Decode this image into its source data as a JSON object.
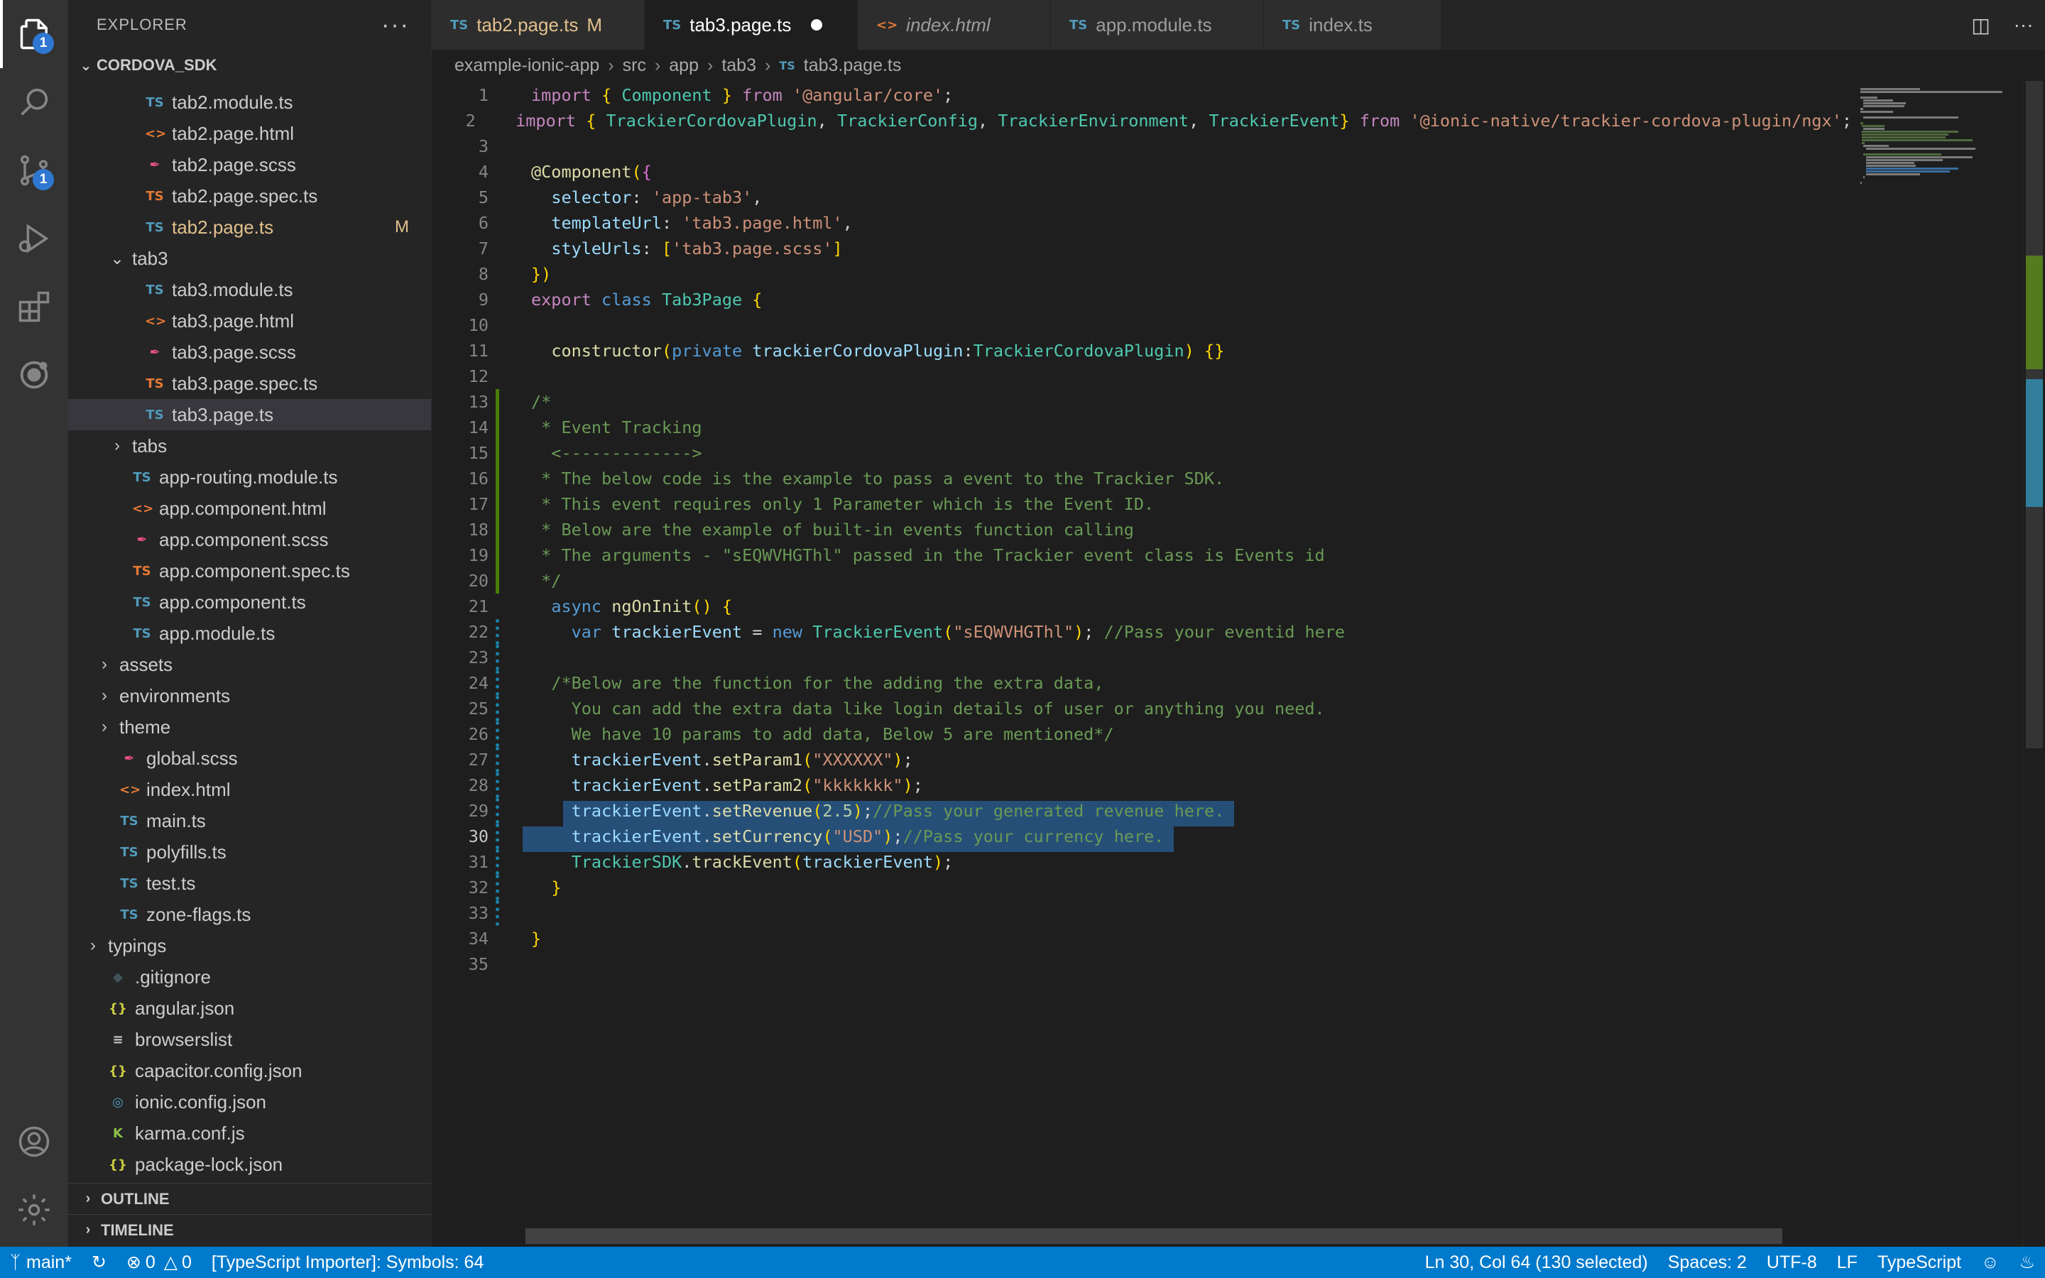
{
  "activity_bar": {
    "explorer_badge": "1",
    "source_control_badge": "1"
  },
  "sidebar": {
    "title": "EXPLORER",
    "more_actions": "···",
    "root": "CORDOVA_SDK",
    "items": [
      {
        "label": "tab2.module.ts",
        "type": "ts",
        "indent": 3
      },
      {
        "label": "tab2.page.html",
        "type": "html",
        "indent": 3
      },
      {
        "label": "tab2.page.scss",
        "type": "scss",
        "indent": 3
      },
      {
        "label": "tab2.page.spec.ts",
        "type": "spec",
        "indent": 3
      },
      {
        "label": "tab2.page.ts",
        "type": "ts",
        "indent": 3,
        "modified": "M"
      },
      {
        "label": "tab3",
        "type": "folder-open",
        "indent": 2
      },
      {
        "label": "tab3.module.ts",
        "type": "ts",
        "indent": 3
      },
      {
        "label": "tab3.page.html",
        "type": "html",
        "indent": 3
      },
      {
        "label": "tab3.page.scss",
        "type": "scss",
        "indent": 3
      },
      {
        "label": "tab3.page.spec.ts",
        "type": "spec",
        "indent": 3
      },
      {
        "label": "tab3.page.ts",
        "type": "ts",
        "indent": 3,
        "selected": true
      },
      {
        "label": "tabs",
        "type": "folder",
        "indent": 2
      },
      {
        "label": "app-routing.module.ts",
        "type": "ts",
        "indent": 2
      },
      {
        "label": "app.component.html",
        "type": "html",
        "indent": 2
      },
      {
        "label": "app.component.scss",
        "type": "scss",
        "indent": 2
      },
      {
        "label": "app.component.spec.ts",
        "type": "spec",
        "indent": 2
      },
      {
        "label": "app.component.ts",
        "type": "ts",
        "indent": 2
      },
      {
        "label": "app.module.ts",
        "type": "ts",
        "indent": 2
      },
      {
        "label": "assets",
        "type": "folder",
        "indent": 1
      },
      {
        "label": "environments",
        "type": "folder",
        "indent": 1
      },
      {
        "label": "theme",
        "type": "folder",
        "indent": 1
      },
      {
        "label": "global.scss",
        "type": "scss",
        "indent": 1
      },
      {
        "label": "index.html",
        "type": "html",
        "indent": 1
      },
      {
        "label": "main.ts",
        "type": "ts",
        "indent": 1
      },
      {
        "label": "polyfills.ts",
        "type": "ts",
        "indent": 1
      },
      {
        "label": "test.ts",
        "type": "ts",
        "indent": 1
      },
      {
        "label": "zone-flags.ts",
        "type": "ts",
        "indent": 1
      },
      {
        "label": "typings",
        "type": "folder",
        "indent": 0
      },
      {
        "label": ".gitignore",
        "type": "git",
        "indent": 0
      },
      {
        "label": "angular.json",
        "type": "json",
        "indent": 0
      },
      {
        "label": "browserslist",
        "type": "list",
        "indent": 0
      },
      {
        "label": "capacitor.config.json",
        "type": "json",
        "indent": 0
      },
      {
        "label": "ionic.config.json",
        "type": "ionic",
        "indent": 0
      },
      {
        "label": "karma.conf.js",
        "type": "karma",
        "indent": 0
      },
      {
        "label": "package-lock.json",
        "type": "json",
        "indent": 0
      }
    ],
    "outline": "OUTLINE",
    "timeline": "TIMELINE"
  },
  "tabs": [
    {
      "label": "tab2.page.ts",
      "icon": "TS",
      "status": "M",
      "kind": "modified"
    },
    {
      "label": "tab3.page.ts",
      "icon": "TS",
      "kind": "active"
    },
    {
      "label": "index.html",
      "icon": "<>",
      "kind": "italic"
    },
    {
      "label": "app.module.ts",
      "icon": "TS",
      "kind": "normal"
    },
    {
      "label": "index.ts",
      "icon": "TS",
      "kind": "normal"
    }
  ],
  "breadcrumbs": [
    "example-ionic-app",
    "src",
    "app",
    "tab3",
    "tab3.page.ts"
  ],
  "breadcrumb_file_icon": "TS",
  "code_lines": [
    "import { Component } from '@angular/core';",
    "import { TrackierCordovaPlugin, TrackierConfig, TrackierEnvironment, TrackierEvent} from '@ionic-native/trackier-cordova-plugin/ngx';",
    "",
    "@Component({",
    "  selector: 'app-tab3',",
    "  templateUrl: 'tab3.page.html',",
    "  styleUrls: ['tab3.page.scss']",
    "})",
    "export class Tab3Page {",
    "",
    "  constructor(private trackierCordovaPlugin:TrackierCordovaPlugin) {}",
    "",
    "/*",
    " * Event Tracking",
    "  <------------->",
    " * The below code is the example to pass a event to the Trackier SDK.",
    " * This event requires only 1 Parameter which is the Event ID.",
    " * Below are the example of built-in events function calling",
    " * The arguments - \"sEQWVHGThl\" passed in the Trackier event class is Events id",
    " */",
    "  async ngOnInit() {",
    "    var trackierEvent = new TrackierEvent(\"sEQWVHGThl\"); //Pass your eventid here",
    "",
    "  /*Below are the function for the adding the extra data,",
    "    You can add the extra data like login details of user or anything you need.",
    "    We have 10 params to add data, Below 5 are mentioned*/",
    "    trackierEvent.setParam1(\"XXXXXX\");",
    "    trackierEvent.setParam2(\"kkkkkkk\");",
    "    trackierEvent.setRevenue(2.5);//Pass your generated revenue here.",
    "    trackierEvent.setCurrency(\"USD\");//Pass your currency here.",
    "    TrackierSDK.trackEvent(trackierEvent);",
    "  }",
    "",
    "}",
    ""
  ],
  "cursor_line": 30,
  "selected_lines": [
    29,
    30
  ],
  "status_bar": {
    "branch": "main*",
    "errors": "0",
    "warnings": "0",
    "importer": "[TypeScript Importer]: Symbols: 64",
    "position": "Ln 30, Col 64 (130 selected)",
    "spaces": "Spaces: 2",
    "encoding": "UTF-8",
    "eol": "LF",
    "language": "TypeScript"
  },
  "colors": {
    "ts": "#519aba",
    "html": "#e37933",
    "scss": "#f55385",
    "spec": "#e37933",
    "json": "#cbcb41",
    "folder": "#c5c5c5",
    "accent": "#007acc",
    "modified": "#e2c08d"
  }
}
